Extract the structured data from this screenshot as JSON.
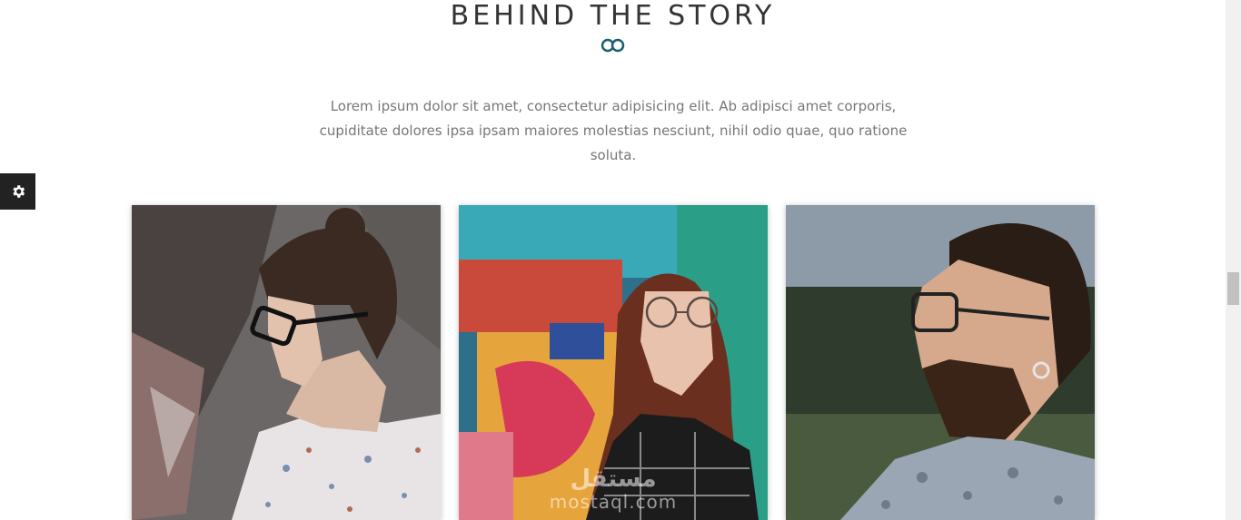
{
  "section": {
    "title": "BEHIND THE STORY",
    "intro": "Lorem ipsum dolor sit amet, consectetur adipisicing elit. Ab adipisci amet corporis, cupiditate dolores ipsa ipsam maiores molestias nesciunt, nihil odio quae, quo ratione soluta."
  },
  "settings": {
    "icon": "gear-icon"
  },
  "team": {
    "members": [
      {
        "photo": "woman-with-glasses-hair-bun-photo"
      },
      {
        "photo": "woman-with-round-glasses-graffiti-photo"
      },
      {
        "photo": "bearded-man-with-glasses-photo"
      }
    ]
  },
  "watermark": {
    "arabic": "مستقل",
    "latin": "mostaql.com"
  },
  "colors": {
    "accent": "#1a5a9e",
    "divider_dark": "#333333",
    "divider_circle": "#1b5f70"
  }
}
